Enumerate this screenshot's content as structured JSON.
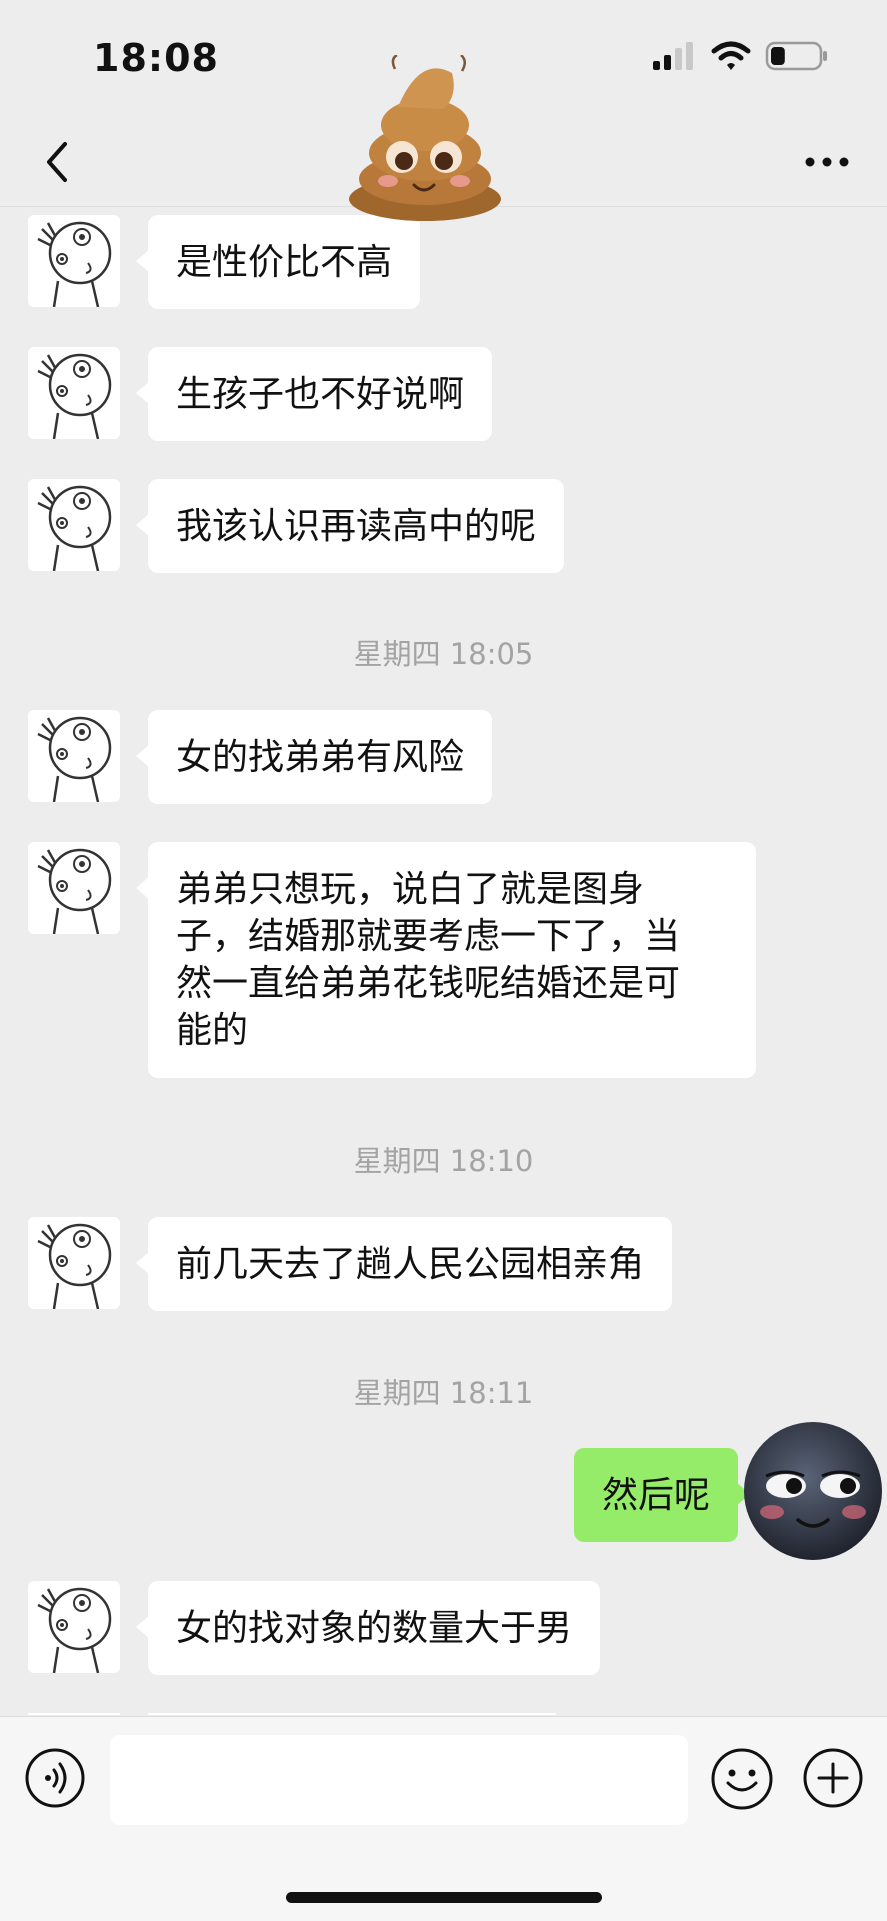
{
  "status_bar": {
    "time": "18:08",
    "battery_percent": 30
  },
  "header": {
    "title_avatar": "poop-emoji",
    "back_icon": "chevron-left-icon",
    "more_icon": "ellipsis-icon"
  },
  "messages": [
    {
      "type": "in",
      "text": "是性价比不高"
    },
    {
      "type": "in",
      "text": "生孩子也不好说啊"
    },
    {
      "type": "in",
      "text": "我该认识再读高中的呢"
    },
    {
      "type": "time",
      "text": "星期四 18:05"
    },
    {
      "type": "in",
      "text": "女的找弟弟有风险"
    },
    {
      "type": "in",
      "lines": [
        "弟弟只想玩，说白了就是图身",
        "子，结婚那就要考虑一下了，当",
        "然一直给弟弟花钱呢结婚还是可",
        "能的"
      ]
    },
    {
      "type": "time",
      "text": "星期四 18:10"
    },
    {
      "type": "in",
      "text": "前几天去了趟人民公园相亲角"
    },
    {
      "type": "time",
      "text": "星期四 18:11"
    },
    {
      "type": "out",
      "text": "然后呢"
    },
    {
      "type": "in",
      "text": "女的找对象的数量大于男"
    }
  ],
  "input_bar": {
    "placeholder": "",
    "voice_icon": "voice-icon",
    "emoji_icon": "smiley-icon",
    "plus_icon": "plus-icon"
  },
  "colors": {
    "background": "#ededed",
    "bubble_in": "#ffffff",
    "bubble_out": "#95ec69",
    "timestamp": "#a3a3a3"
  }
}
